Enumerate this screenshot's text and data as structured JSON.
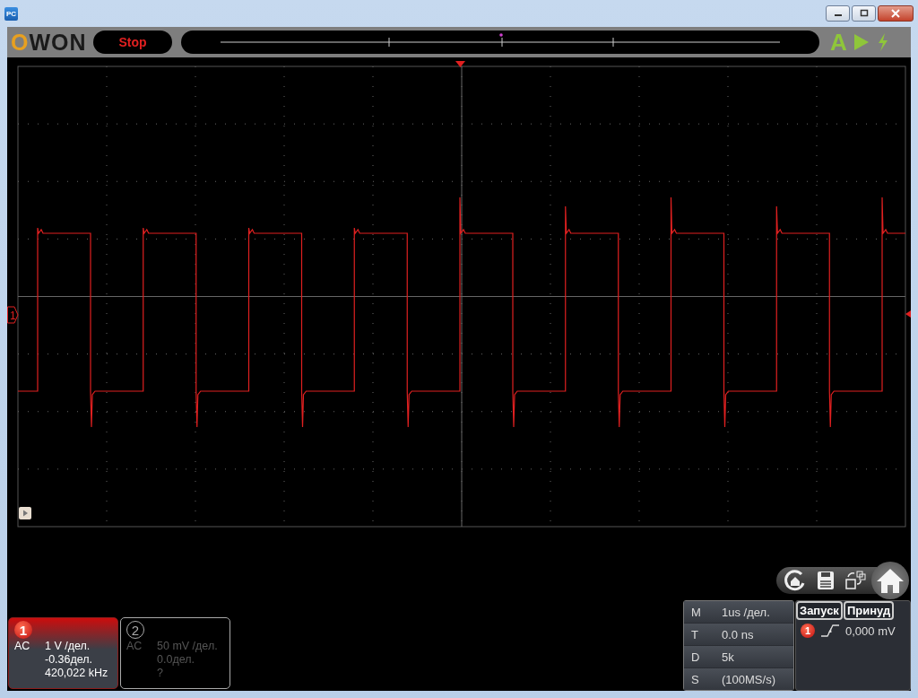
{
  "window": {
    "app_icon": "PC"
  },
  "toolbar": {
    "logo": "OWON",
    "run_state": "Stop",
    "auto_button": "A"
  },
  "scope": {
    "channel_marker": "1"
  },
  "channels": [
    {
      "number": "1",
      "coupling": "AC",
      "scale": "1 V /дел.",
      "offset": "-0.36дел.",
      "frequency": "420,022 kHz",
      "selected": true
    },
    {
      "number": "2",
      "coupling": "AC",
      "scale": "50 mV /дел.",
      "offset": "0.0дел.",
      "frequency": "?",
      "selected": false
    }
  ],
  "timebase": [
    {
      "key": "M",
      "value": "1us /дел."
    },
    {
      "key": "T",
      "value": "0.0 ns"
    },
    {
      "key": "D",
      "value": "5k"
    },
    {
      "key": "S",
      "value": "(100MS/s)"
    }
  ],
  "trigger": {
    "tabs": [
      "Запуск",
      "Принуд"
    ],
    "channel": "1",
    "level": "0,000 mV"
  }
}
